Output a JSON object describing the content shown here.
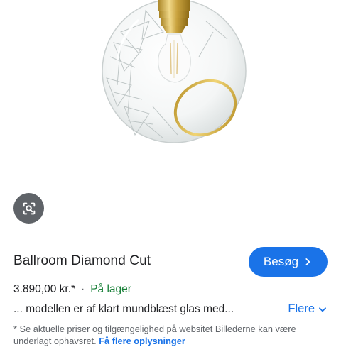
{
  "product": {
    "title": "Ballroom Diamond Cut",
    "price": "3.890,00 kr.*",
    "separator": "·",
    "stock": "På lager",
    "description": "... modellen er af klart mundblæst glas med...",
    "more_label": "Flere",
    "visit_label": "Besøg",
    "disclaimer_text": "* Se aktuelle priser og tilgængelighed på websitet Billederne kan være underlagt ophavsret.",
    "disclaimer_link": "Få flere oplysninger"
  },
  "icons": {
    "lens": "lens-search-icon",
    "visit_chevron": "chevron-right-icon",
    "more_chevron": "chevron-down-icon"
  },
  "colors": {
    "accent": "#1a73e8",
    "stock": "#188038",
    "lens_bg": "#5f6368"
  }
}
